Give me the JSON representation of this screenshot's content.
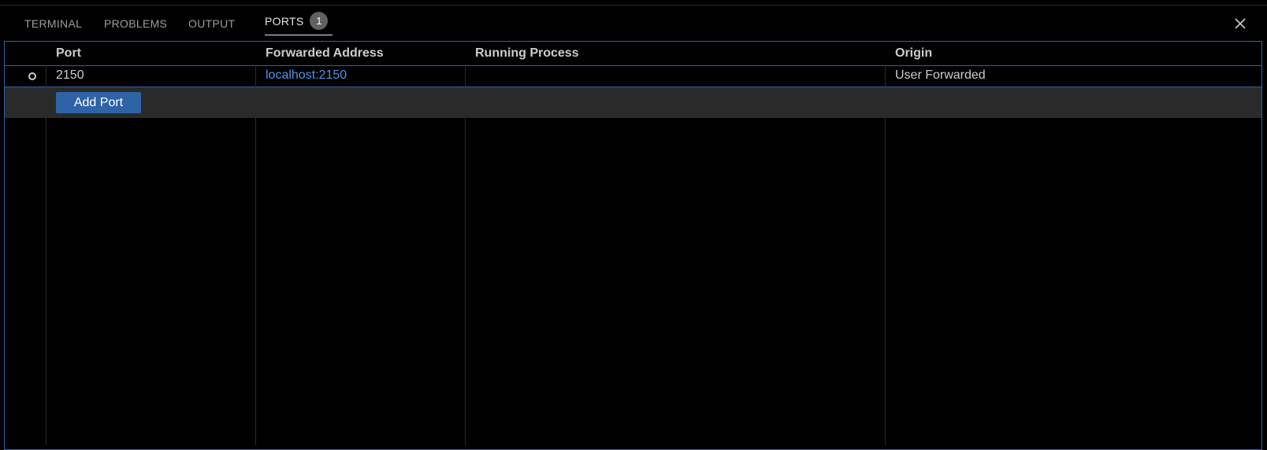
{
  "tabs": [
    {
      "label": "TERMINAL"
    },
    {
      "label": "PROBLEMS"
    },
    {
      "label": "OUTPUT"
    },
    {
      "label": "PORTS",
      "badge": "1",
      "active": true
    }
  ],
  "table": {
    "headers": {
      "port": "Port",
      "forwarded_address": "Forwarded Address",
      "running_process": "Running Process",
      "origin": "Origin"
    },
    "rows": [
      {
        "status_icon": "circle-outline-icon",
        "port": "2150",
        "forwarded_address": "localhost:2150",
        "running_process": "",
        "origin": "User Forwarded"
      }
    ],
    "add_port_label": "Add Port"
  },
  "icons": {
    "close": "close-icon"
  },
  "colors": {
    "accent": "#2e63a6",
    "link": "#4e94ea",
    "focus_border": "#2f63a8",
    "background": "#000000"
  }
}
